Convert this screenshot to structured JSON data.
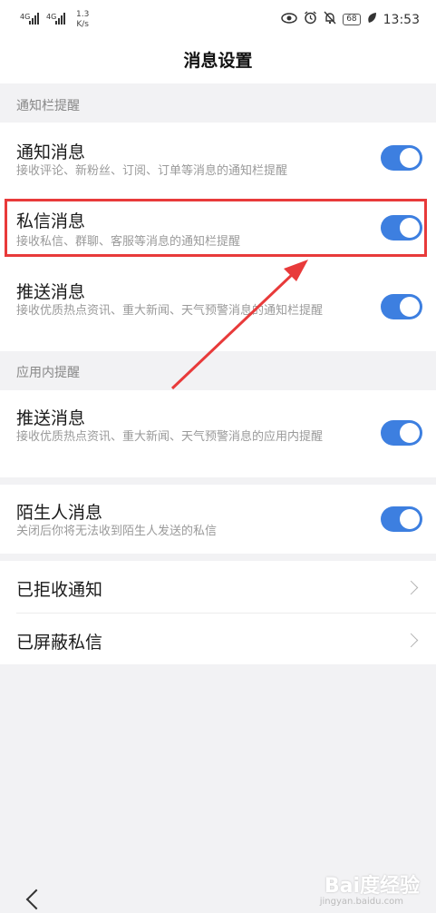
{
  "status_bar": {
    "signal1": "4G",
    "signal2": "4G",
    "speed_value": "1.3",
    "speed_unit": "K/s",
    "battery": "68",
    "time": "13:53",
    "icons": [
      "eye-icon",
      "alarm-icon",
      "mute-icon",
      "battery-icon",
      "leaf-icon"
    ]
  },
  "header": {
    "title": "消息设置"
  },
  "sections": {
    "notification_bar": {
      "label": "通知栏提醒",
      "items": [
        {
          "title": "通知消息",
          "subtitle": "接收评论、新粉丝、订阅、订单等消息的通知栏提醒",
          "enabled": true
        },
        {
          "title": "私信消息",
          "subtitle": "接收私信、群聊、客服等消息的通知栏提醒",
          "enabled": true
        },
        {
          "title": "推送消息",
          "subtitle": "接收优质热点资讯、重大新闻、天气预警消息的通知栏提醒",
          "enabled": true
        }
      ]
    },
    "in_app": {
      "label": "应用内提醒",
      "items": [
        {
          "title": "推送消息",
          "subtitle": "接收优质热点资讯、重大新闻、天气预警消息的应用内提醒",
          "enabled": true
        }
      ]
    },
    "stranger": {
      "items": [
        {
          "title": "陌生人消息",
          "subtitle": "关闭后你将无法收到陌生人发送的私信",
          "enabled": true
        }
      ]
    },
    "lists": {
      "items": [
        {
          "title": "已拒收通知"
        },
        {
          "title": "已屏蔽私信"
        }
      ]
    }
  },
  "watermark": {
    "text": "Bai度经验",
    "sub": "jingyan.baidu.com"
  },
  "colors": {
    "toggle_on": "#3d7fe0",
    "highlight": "#e83a3a",
    "background": "#f2f2f4"
  }
}
